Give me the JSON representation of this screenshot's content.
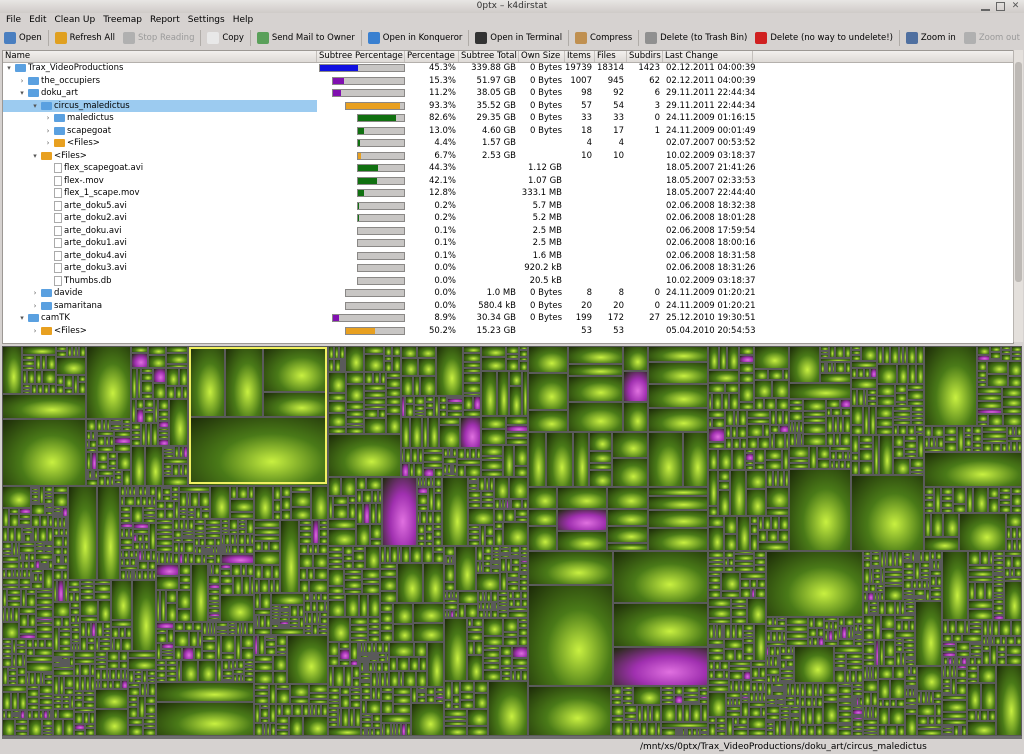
{
  "window": {
    "title": "0ptx – k4dirstat"
  },
  "menu": [
    "File",
    "Edit",
    "Clean Up",
    "Treemap",
    "Report",
    "Settings",
    "Help"
  ],
  "toolbar": [
    {
      "label": "Open",
      "icon": "folder-open-icon",
      "color": "#4a7fc0",
      "enabled": true
    },
    {
      "label": "Refresh All",
      "icon": "refresh-icon",
      "color": "#e0a020",
      "enabled": true
    },
    {
      "label": "Stop Reading",
      "icon": "stop-icon",
      "color": "#b0b0b0",
      "enabled": false
    },
    {
      "label": "Copy",
      "icon": "copy-icon",
      "color": "#e8e8e8",
      "enabled": true
    },
    {
      "label": "Send Mail to Owner",
      "icon": "mail-icon",
      "color": "#5aa05a",
      "enabled": true
    },
    {
      "label": "Open in Konqueror",
      "icon": "konqueror-icon",
      "color": "#3a80d0",
      "enabled": true
    },
    {
      "label": "Open in Terminal",
      "icon": "terminal-icon",
      "color": "#333333",
      "enabled": true
    },
    {
      "label": "Compress",
      "icon": "compress-icon",
      "color": "#c09050",
      "enabled": true
    },
    {
      "label": "Delete (to Trash Bin)",
      "icon": "trash-icon",
      "color": "#909090",
      "enabled": true
    },
    {
      "label": "Delete (no way to undelete!)",
      "icon": "delete-icon",
      "color": "#d02020",
      "enabled": true
    },
    {
      "label": "Zoom in",
      "icon": "zoom-in-icon",
      "color": "#5070a0",
      "enabled": true
    },
    {
      "label": "Zoom out",
      "icon": "zoom-out-icon",
      "color": "#b0b0b0",
      "enabled": false
    }
  ],
  "columns": [
    "Name",
    "Subtree Percentage",
    "Percentage",
    "Subtree Total",
    "Own Size",
    "Items",
    "Files",
    "Subdirs",
    "Last Change"
  ],
  "rows": [
    {
      "name": "Trax_VideoProductions",
      "depth": 0,
      "arrow": "▾",
      "type": "folder",
      "bar": 0.45,
      "barColor": "#1010e0",
      "pct": "45.3%",
      "total": "339.88 GB",
      "own": "0 Bytes",
      "items": "19739",
      "files": "18314",
      "subdirs": "1423",
      "date": "02.12.2011  04:00:39"
    },
    {
      "name": "the_occupiers",
      "depth": 1,
      "arrow": "›",
      "type": "folder",
      "bar": 0.153,
      "barColor": "#8010b0",
      "pct": "15.3%",
      "total": "51.97 GB",
      "own": "0 Bytes",
      "items": "1007",
      "files": "945",
      "subdirs": "62",
      "date": "02.12.2011  04:00:39"
    },
    {
      "name": "doku_art",
      "depth": 1,
      "arrow": "▾",
      "type": "folder",
      "bar": 0.112,
      "barColor": "#8010b0",
      "pct": "11.2%",
      "total": "38.05 GB",
      "own": "0 Bytes",
      "items": "98",
      "files": "92",
      "subdirs": "6",
      "date": "29.11.2011  22:44:34"
    },
    {
      "name": "circus_maledictus",
      "depth": 2,
      "arrow": "▾",
      "type": "folder",
      "bar": 0.933,
      "barColor": "#e8a020",
      "pct": "93.3%",
      "total": "35.52 GB",
      "own": "0 Bytes",
      "items": "57",
      "files": "54",
      "subdirs": "3",
      "date": "29.11.2011  22:44:34",
      "selected": true
    },
    {
      "name": "maledictus",
      "depth": 3,
      "arrow": "›",
      "type": "folder",
      "bar": 0.826,
      "barColor": "#107010",
      "pct": "82.6%",
      "total": "29.35 GB",
      "own": "0 Bytes",
      "items": "33",
      "files": "33",
      "subdirs": "0",
      "date": "24.11.2009  01:16:15"
    },
    {
      "name": "scapegoat",
      "depth": 3,
      "arrow": "›",
      "type": "folder",
      "bar": 0.13,
      "barColor": "#107010",
      "pct": "13.0%",
      "total": "4.60 GB",
      "own": "0 Bytes",
      "items": "18",
      "files": "17",
      "subdirs": "1",
      "date": "24.11.2009  00:01:49"
    },
    {
      "name": "<Files>",
      "depth": 3,
      "arrow": "›",
      "type": "files",
      "bar": 0.044,
      "barColor": "#107010",
      "pct": "4.4%",
      "total": "1.57 GB",
      "own": "",
      "items": "4",
      "files": "4",
      "subdirs": "",
      "date": "02.07.2007  00:53:52"
    },
    {
      "name": "<Files>",
      "depth": 2,
      "arrow": "▾",
      "type": "files",
      "bar": 0.067,
      "barColor": "#e8a020",
      "pct": "6.7%",
      "total": "2.53 GB",
      "own": "",
      "items": "10",
      "files": "10",
      "subdirs": "",
      "date": "10.02.2009  03:18:37"
    },
    {
      "name": "flex_scapegoat.avi",
      "depth": 3,
      "arrow": "",
      "type": "file",
      "bar": 0.443,
      "barColor": "#107010",
      "pct": "44.3%",
      "total": "",
      "own": "1.12 GB",
      "items": "",
      "files": "",
      "subdirs": "",
      "date": "18.05.2007  21:41:26"
    },
    {
      "name": "flex-.mov",
      "depth": 3,
      "arrow": "",
      "type": "file",
      "bar": 0.421,
      "barColor": "#107010",
      "pct": "42.1%",
      "total": "",
      "own": "1.07 GB",
      "items": "",
      "files": "",
      "subdirs": "",
      "date": "18.05.2007  02:33:53"
    },
    {
      "name": "flex_1_scape.mov",
      "depth": 3,
      "arrow": "",
      "type": "file",
      "bar": 0.128,
      "barColor": "#107010",
      "pct": "12.8%",
      "total": "",
      "own": "333.1 MB",
      "items": "",
      "files": "",
      "subdirs": "",
      "date": "18.05.2007  22:44:40"
    },
    {
      "name": "arte_doku5.avi",
      "depth": 3,
      "arrow": "",
      "type": "file",
      "bar": 0.002,
      "barColor": "#107010",
      "pct": "0.2%",
      "total": "",
      "own": "5.7 MB",
      "items": "",
      "files": "",
      "subdirs": "",
      "date": "02.06.2008  18:32:38"
    },
    {
      "name": "arte_doku2.avi",
      "depth": 3,
      "arrow": "",
      "type": "file",
      "bar": 0.002,
      "barColor": "#107010",
      "pct": "0.2%",
      "total": "",
      "own": "5.2 MB",
      "items": "",
      "files": "",
      "subdirs": "",
      "date": "02.06.2008  18:01:28"
    },
    {
      "name": "arte_doku.avi",
      "depth": 3,
      "arrow": "",
      "type": "file",
      "bar": 0.001,
      "barColor": "#107010",
      "pct": "0.1%",
      "total": "",
      "own": "2.5 MB",
      "items": "",
      "files": "",
      "subdirs": "",
      "date": "02.06.2008  17:59:54"
    },
    {
      "name": "arte_doku1.avi",
      "depth": 3,
      "arrow": "",
      "type": "file",
      "bar": 0.001,
      "barColor": "#107010",
      "pct": "0.1%",
      "total": "",
      "own": "2.5 MB",
      "items": "",
      "files": "",
      "subdirs": "",
      "date": "02.06.2008  18:00:16"
    },
    {
      "name": "arte_doku4.avi",
      "depth": 3,
      "arrow": "",
      "type": "file",
      "bar": 0.001,
      "barColor": "#107010",
      "pct": "0.1%",
      "total": "",
      "own": "1.6 MB",
      "items": "",
      "files": "",
      "subdirs": "",
      "date": "02.06.2008  18:31:58"
    },
    {
      "name": "arte_doku3.avi",
      "depth": 3,
      "arrow": "",
      "type": "file",
      "bar": 0.0,
      "barColor": "#107010",
      "pct": "0.0%",
      "total": "",
      "own": "920.2 kB",
      "items": "",
      "files": "",
      "subdirs": "",
      "date": "02.06.2008  18:31:26"
    },
    {
      "name": "Thumbs.db",
      "depth": 3,
      "arrow": "",
      "type": "file",
      "bar": 0.0,
      "barColor": "#107010",
      "pct": "0.0%",
      "total": "",
      "own": "20.5 kB",
      "items": "",
      "files": "",
      "subdirs": "",
      "date": "10.02.2009  03:18:37"
    },
    {
      "name": "davide",
      "depth": 2,
      "arrow": "›",
      "type": "folder",
      "bar": 0.0,
      "barColor": "#e8a020",
      "pct": "0.0%",
      "total": "1.0 MB",
      "own": "0 Bytes",
      "items": "8",
      "files": "8",
      "subdirs": "0",
      "date": "24.11.2009  01:20:21"
    },
    {
      "name": "samaritana",
      "depth": 2,
      "arrow": "›",
      "type": "folder",
      "bar": 0.0,
      "barColor": "#e8a020",
      "pct": "0.0%",
      "total": "580.4 kB",
      "own": "0 Bytes",
      "items": "20",
      "files": "20",
      "subdirs": "0",
      "date": "24.11.2009  01:20:21"
    },
    {
      "name": "camTK",
      "depth": 1,
      "arrow": "▾",
      "type": "folder",
      "bar": 0.089,
      "barColor": "#8010b0",
      "pct": "8.9%",
      "total": "30.34 GB",
      "own": "0 Bytes",
      "items": "199",
      "files": "172",
      "subdirs": "27",
      "date": "25.12.2010  19:30:51"
    },
    {
      "name": "<Files>",
      "depth": 2,
      "arrow": "›",
      "type": "files",
      "bar": 0.502,
      "barColor": "#e8a020",
      "pct": "50.2%",
      "total": "15.23 GB",
      "own": "",
      "items": "53",
      "files": "53",
      "subdirs": "",
      "date": "05.04.2010  20:54:53"
    }
  ],
  "colors": {
    "folder": "#5aa0e0",
    "files": "#e8a020",
    "selection": "#9ccbf0",
    "tileGreen": "#4a7a18",
    "tileHighlight": "#c8f040",
    "tilePurple": "#a030b0",
    "treemapHighlight": "#f0f060"
  },
  "status": {
    "path": "/mnt/xs/0ptx/Trax_VideoProductions/doku_art/circus_maledictus"
  }
}
